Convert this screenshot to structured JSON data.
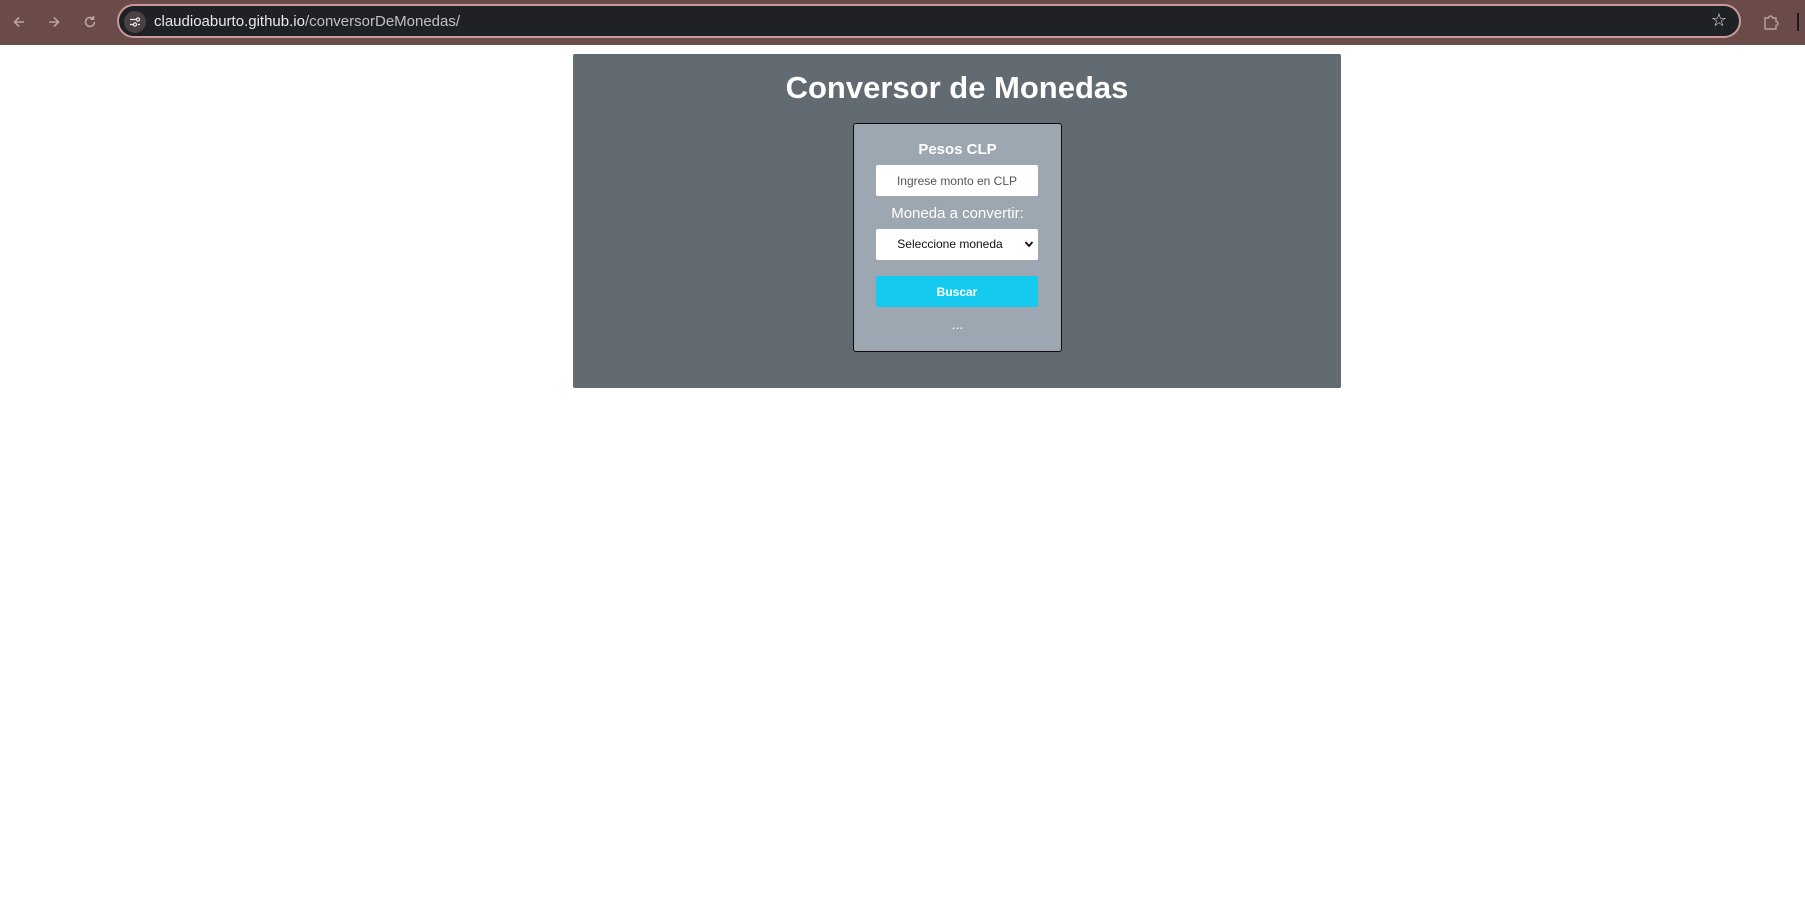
{
  "browser": {
    "url_host": "claudioaburto.github.io",
    "url_path": "/conversorDeMonedas/",
    "icons": [
      "back-arrow-icon",
      "forward-arrow-icon",
      "reload-icon",
      "site-info-icon",
      "bookmark-star-icon",
      "extensions-icon"
    ]
  },
  "app": {
    "title": "Conversor de Monedas",
    "pesos_label": "Pesos CLP",
    "amount_placeholder": "Ingrese monto en CLP",
    "currency_label": "Moneda a convertir:",
    "currency_selected": "Seleccione moneda",
    "search_label": "Buscar",
    "result_text": "..."
  },
  "colors": {
    "panel_bg": "#626a72",
    "card_bg": "#9da7b1",
    "button_bg": "#14cbef",
    "browser_frame": "#6b4a4a"
  }
}
